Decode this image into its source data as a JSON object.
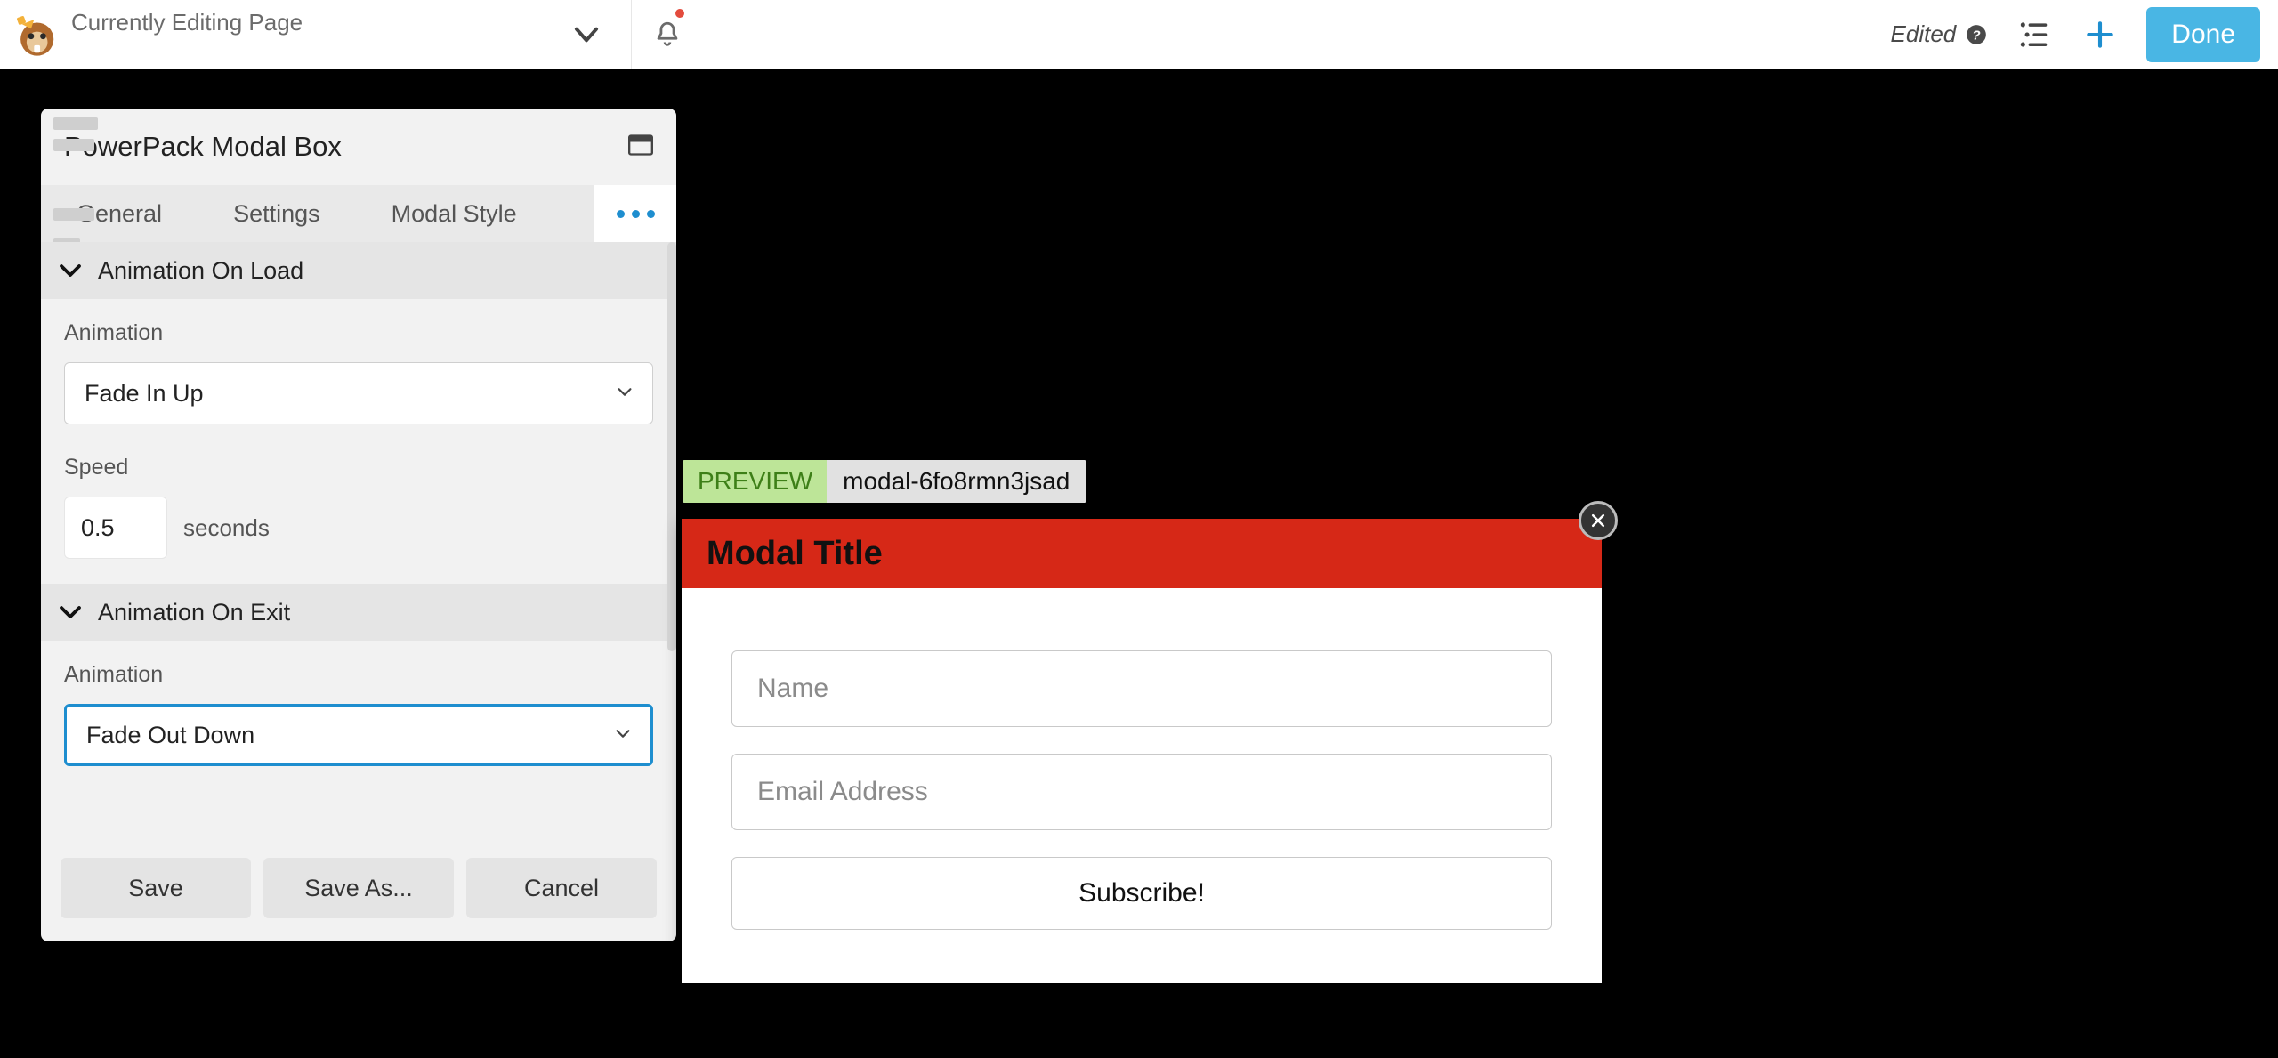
{
  "toolbar": {
    "page_title": "Currently Editing Page",
    "edited_label": "Edited",
    "done_label": "Done"
  },
  "panel": {
    "title": "PowerPack Modal Box",
    "tabs": [
      "General",
      "Settings",
      "Modal Style"
    ],
    "sections": {
      "load": {
        "title": "Animation On Load",
        "animation_label": "Animation",
        "animation_value": "Fade In Up",
        "speed_label": "Speed",
        "speed_value": "0.5",
        "speed_unit": "seconds"
      },
      "exit": {
        "title": "Animation On Exit",
        "animation_label": "Animation",
        "animation_value": "Fade Out Down"
      }
    },
    "footer": {
      "save": "Save",
      "save_as": "Save As...",
      "cancel": "Cancel"
    }
  },
  "preview": {
    "tag": "PREVIEW",
    "id": "modal-6fo8rmn3jsad"
  },
  "modal": {
    "title": "Modal Title",
    "name_placeholder": "Name",
    "email_placeholder": "Email Address",
    "submit_label": "Subscribe!"
  }
}
